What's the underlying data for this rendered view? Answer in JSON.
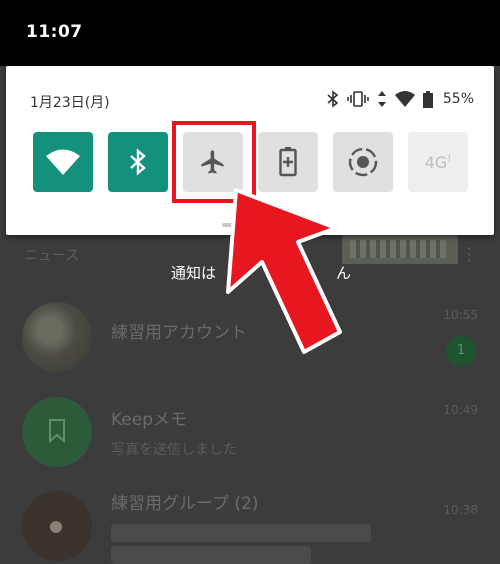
{
  "status_bar": {
    "time": "11:07"
  },
  "quick_settings": {
    "date": "1月23日(月)",
    "battery_percent": "55%",
    "status_icons": [
      "bluetooth-icon",
      "vibrate-icon",
      "signal-icon",
      "wifi-signal-icon",
      "battery-icon"
    ],
    "tiles": [
      {
        "name": "wifi",
        "icon": "wifi-icon",
        "state": "on"
      },
      {
        "name": "bluetooth",
        "icon": "bluetooth-icon",
        "state": "on"
      },
      {
        "name": "airplane",
        "icon": "airplane-icon",
        "state": "off",
        "highlighted": true
      },
      {
        "name": "battery-saver",
        "icon": "battery-saver-icon",
        "state": "off"
      },
      {
        "name": "auto-rotate",
        "icon": "rotate-icon",
        "state": "off"
      },
      {
        "name": "mobile-data",
        "icon": "4g-icon",
        "state": "unavailable",
        "label": "4G"
      }
    ],
    "colors": {
      "tile_on": "#14917c",
      "tile_off": "#e0e0e0",
      "highlight": "#e8161e"
    }
  },
  "background": {
    "section_label": "ニュース",
    "no_notifications_text": "通知は",
    "no_notifications_suffix": "ん",
    "chats": [
      {
        "title": "練習用アカウント",
        "subtitle": "",
        "time": "10:55",
        "unread": "1"
      },
      {
        "title": "Keepメモ",
        "subtitle": "写真を送信しました",
        "time": "10:49"
      },
      {
        "title": "練習用グループ (2)",
        "subtitle": "",
        "time": "10:38"
      }
    ]
  },
  "annotation": {
    "arrow_color": "#e8161e"
  }
}
